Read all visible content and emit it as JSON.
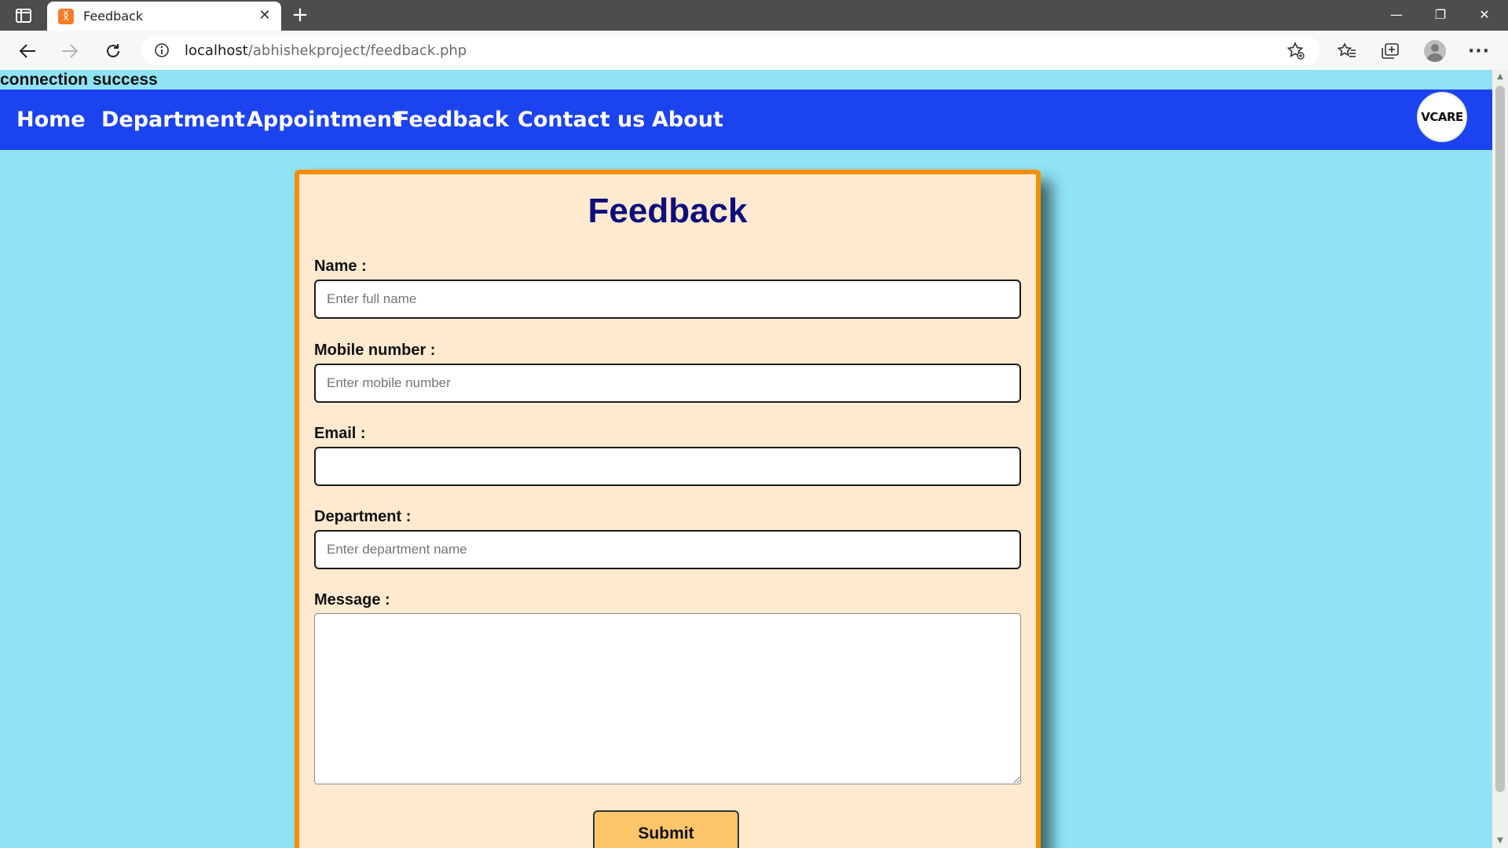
{
  "browser": {
    "tab_title": "Feedback",
    "tab_close_icon": "close-icon",
    "new_tab_glyph": "+",
    "url_host": "localhost",
    "url_path": "/abhishekproject/feedback.php",
    "window_minimize": "—",
    "window_restore": "❐",
    "window_close": "✕"
  },
  "page": {
    "status_message": "connection success",
    "nav": [
      {
        "label": "Home"
      },
      {
        "label": "Department"
      },
      {
        "label": "Appointment"
      },
      {
        "label": "Feedback"
      },
      {
        "label": "Contact us"
      },
      {
        "label": "About"
      }
    ],
    "logo_text": "VCARE",
    "form": {
      "title": "Feedback",
      "name_label": "Name :",
      "name_placeholder": "Enter full name",
      "mobile_label": "Mobile number :",
      "mobile_placeholder": "Enter mobile number",
      "email_label": "Email :",
      "email_placeholder": "",
      "department_label": "Department :",
      "department_placeholder": "Enter department name",
      "message_label": "Message :",
      "submit_label": "Submit"
    }
  },
  "colors": {
    "page_background": "#8fe3f4",
    "navbar": "#1b43ef",
    "card_background": "#ffead0",
    "card_border": "#f68e00",
    "title": "#0c0c7c",
    "submit_button": "#fec66a"
  }
}
